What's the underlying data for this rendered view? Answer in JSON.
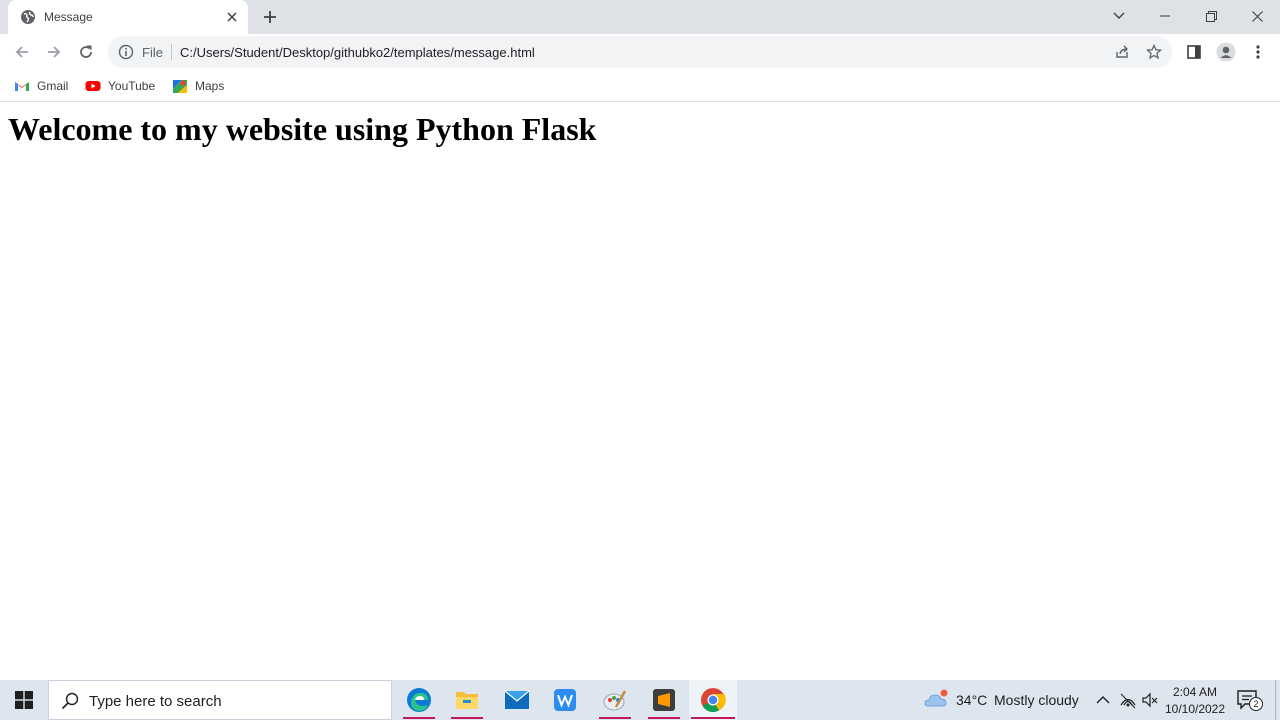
{
  "browser": {
    "tab": {
      "title": "Message"
    },
    "address_bar": {
      "scheme_label": "File",
      "url": "C:/Users/Student/Desktop/githubko2/templates/message.html"
    },
    "bookmarks": [
      {
        "label": "Gmail",
        "icon": "gmail-icon"
      },
      {
        "label": "YouTube",
        "icon": "youtube-icon"
      },
      {
        "label": "Maps",
        "icon": "maps-icon"
      }
    ]
  },
  "page": {
    "heading": "Welcome to my website using Python Flask"
  },
  "taskbar": {
    "search_placeholder": "Type here to search",
    "apps": [
      "edge-icon",
      "file-explorer-icon",
      "mail-icon",
      "wps-office-icon",
      "paint-icon",
      "sublime-text-icon",
      "chrome-icon"
    ],
    "weather": {
      "temperature": "34°C",
      "condition": "Mostly cloudy"
    },
    "clock": {
      "time": "2:04 AM",
      "date": "10/10/2022"
    },
    "notifications": {
      "count": "2"
    }
  },
  "colors": {
    "tabstrip": "#dee1e6",
    "omnibox": "#f1f3f4",
    "taskbar": "#dde6ef",
    "running_indicator": "#c2185b"
  }
}
